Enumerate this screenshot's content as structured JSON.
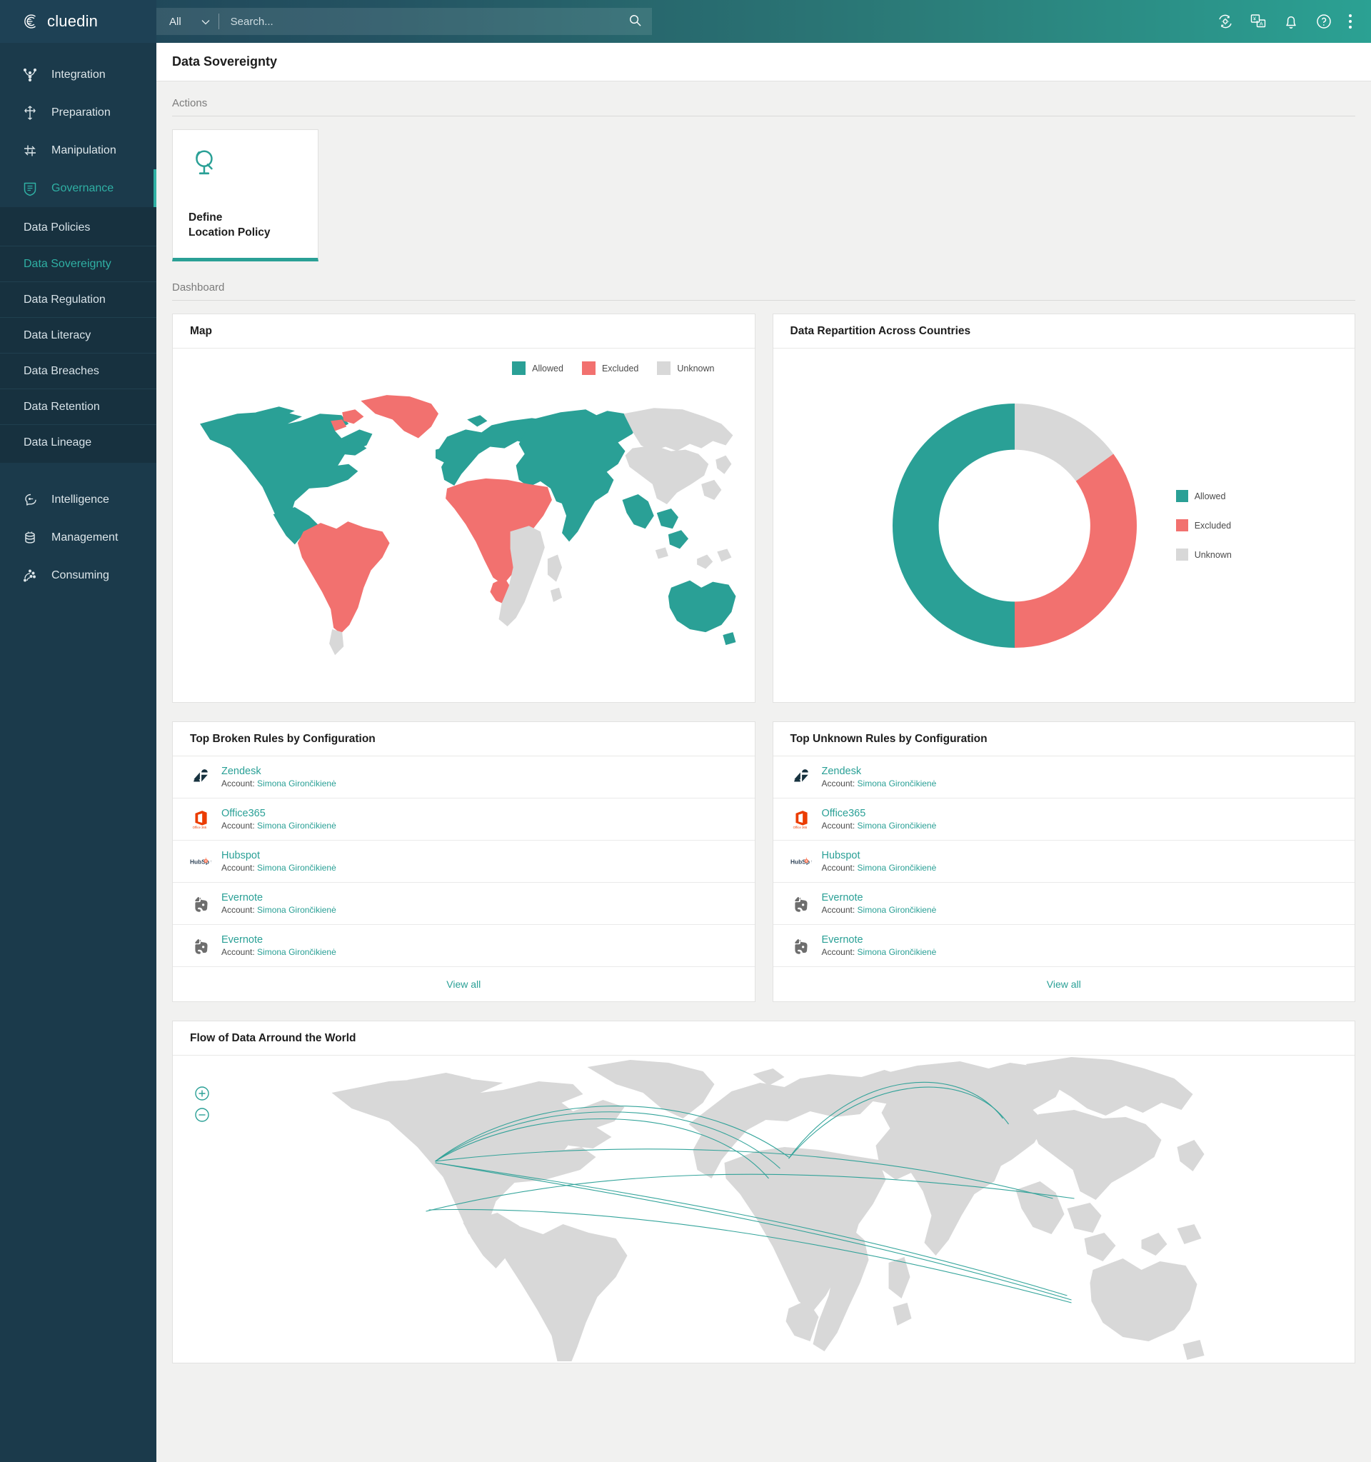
{
  "brand": {
    "name": "cluedin",
    "logo_icon": "cluedin-logo-icon"
  },
  "search": {
    "scope_label": "All",
    "placeholder": "Search...",
    "value": "",
    "search_icon": "search-icon",
    "chevron_icon": "chevron-down-icon"
  },
  "topbar_actions": [
    {
      "name": "sync-settings-icon",
      "label": "Sync Settings"
    },
    {
      "name": "language-icon",
      "label": "Language"
    },
    {
      "name": "notifications-bell-icon",
      "label": "Notifications"
    },
    {
      "name": "help-icon",
      "label": "Help"
    },
    {
      "name": "more-menu-icon",
      "label": "More"
    }
  ],
  "sidebar": {
    "items": [
      {
        "label": "Integration",
        "icon": "integration-icon",
        "active": false
      },
      {
        "label": "Preparation",
        "icon": "preparation-icon",
        "active": false
      },
      {
        "label": "Manipulation",
        "icon": "manipulation-icon",
        "active": false
      },
      {
        "label": "Governance",
        "icon": "governance-shield-icon",
        "active": true
      }
    ],
    "sub_items": [
      {
        "label": "Data Policies",
        "active": false
      },
      {
        "label": "Data Sovereignty",
        "active": true
      },
      {
        "label": "Data Regulation",
        "active": false
      },
      {
        "label": "Data Literacy",
        "active": false
      },
      {
        "label": "Data Breaches",
        "active": false
      },
      {
        "label": "Data Retention",
        "active": false
      },
      {
        "label": "Data Lineage",
        "active": false
      }
    ],
    "items_bottom": [
      {
        "label": "Intelligence",
        "icon": "intelligence-icon",
        "active": false
      },
      {
        "label": "Management",
        "icon": "management-database-icon",
        "active": false
      },
      {
        "label": "Consuming",
        "icon": "consuming-icon",
        "active": false
      }
    ]
  },
  "page": {
    "title": "Data Sovereignty"
  },
  "sections": {
    "actions_label": "Actions",
    "dashboard_label": "Dashboard"
  },
  "actions": [
    {
      "icon": "globe-icon",
      "label_line1": "Define",
      "label_line2": "Location Policy"
    }
  ],
  "colors": {
    "allowed": "#2aa096",
    "excluded": "#f2716f",
    "unknown": "#d8d8d8",
    "accent": "#2aa096",
    "sidebar": "#1b3a4b",
    "sidebar_sub": "#17313f"
  },
  "cards": {
    "map": {
      "title": "Map",
      "legend": [
        {
          "label": "Allowed",
          "color": "#2aa096"
        },
        {
          "label": "Excluded",
          "color": "#f2716f"
        },
        {
          "label": "Unknown",
          "color": "#d8d8d8"
        }
      ]
    },
    "repartition": {
      "title": "Data Repartition Across Countries",
      "legend": [
        {
          "label": "Allowed",
          "color": "#2aa096"
        },
        {
          "label": "Excluded",
          "color": "#f2716f"
        },
        {
          "label": "Unknown",
          "color": "#d8d8d8"
        }
      ]
    },
    "broken_rules": {
      "title": "Top Broken Rules by Configuration",
      "view_all": "View all",
      "account_prefix": "Account:",
      "rows": [
        {
          "provider": "Zendesk",
          "logo": "zendesk-logo-icon",
          "account": "Simona Girončikienė"
        },
        {
          "provider": "Office365",
          "logo": "office365-logo-icon",
          "account": "Simona Girončikienė"
        },
        {
          "provider": "Hubspot",
          "logo": "hubspot-logo-icon",
          "account": "Simona Girončikienė"
        },
        {
          "provider": "Evernote",
          "logo": "evernote-logo-icon",
          "account": "Simona Girončikienė"
        },
        {
          "provider": "Evernote",
          "logo": "evernote-logo-icon",
          "account": "Simona Girončikienė"
        }
      ]
    },
    "unknown_rules": {
      "title": "Top Unknown Rules by Configuration",
      "view_all": "View all",
      "account_prefix": "Account:",
      "rows": [
        {
          "provider": "Zendesk",
          "logo": "zendesk-logo-icon",
          "account": "Simona Girončikienė"
        },
        {
          "provider": "Office365",
          "logo": "office365-logo-icon",
          "account": "Simona Girončikienė"
        },
        {
          "provider": "Hubspot",
          "logo": "hubspot-logo-icon",
          "account": "Simona Girončikienė"
        },
        {
          "provider": "Evernote",
          "logo": "evernote-logo-icon",
          "account": "Simona Girončikienė"
        },
        {
          "provider": "Evernote",
          "logo": "evernote-logo-icon",
          "account": "Simona Girončikienė"
        }
      ]
    },
    "flow": {
      "title": "Flow of Data Arround the World",
      "zoom_in_icon": "zoom-in-icon",
      "zoom_out_icon": "zoom-out-icon"
    }
  },
  "chart_data": [
    {
      "type": "pie",
      "title": "Data Repartition Across Countries",
      "categories": [
        "Unknown",
        "Excluded",
        "Allowed"
      ],
      "values": [
        15,
        35,
        50
      ],
      "colors": [
        "#d8d8d8",
        "#f2716f",
        "#2aa096"
      ],
      "legend_position": "right",
      "donut": true,
      "inner_radius_ratio": 0.62,
      "start_angle_deg": 0
    },
    {
      "type": "heatmap",
      "title": "Map",
      "subtype": "choropleth",
      "legend": [
        "Allowed",
        "Excluded",
        "Unknown"
      ],
      "legend_colors": [
        "#2aa096",
        "#f2716f",
        "#d8d8d8"
      ],
      "regions": [
        {
          "name": "North America",
          "status": "Allowed",
          "color": "#2aa096"
        },
        {
          "name": "Greenland",
          "status": "Excluded",
          "color": "#f2716f"
        },
        {
          "name": "Iceland",
          "status": "Excluded",
          "color": "#f2716f"
        },
        {
          "name": "South America",
          "status": "Excluded",
          "color": "#f2716f"
        },
        {
          "name": "Europe",
          "status": "Allowed",
          "color": "#2aa096"
        },
        {
          "name": "Northern Africa",
          "status": "Excluded",
          "color": "#f2716f"
        },
        {
          "name": "Southern Africa",
          "status": "Unknown",
          "color": "#d8d8d8"
        },
        {
          "name": "Russia and Central Asia",
          "status": "Allowed",
          "color": "#2aa096"
        },
        {
          "name": "Eastern Siberia",
          "status": "Unknown",
          "color": "#d8d8d8"
        },
        {
          "name": "Southeast Asia",
          "status": "Allowed",
          "color": "#2aa096"
        },
        {
          "name": "China",
          "status": "Unknown",
          "color": "#d8d8d8"
        },
        {
          "name": "Australia",
          "status": "Allowed",
          "color": "#2aa096"
        }
      ]
    },
    {
      "type": "line",
      "title": "Flow of Data Arround the World",
      "subtype": "flow-map",
      "basemap_color": "#d8d8d8",
      "flow_color": "#2aa096",
      "flows": [
        {
          "from": "North America",
          "to": "Europe"
        },
        {
          "from": "North America",
          "to": "Europe"
        },
        {
          "from": "North America",
          "to": "Europe"
        },
        {
          "from": "North America",
          "to": "Asia"
        },
        {
          "from": "Europe",
          "to": "Asia"
        },
        {
          "from": "Europe",
          "to": "Asia"
        },
        {
          "from": "North America",
          "to": "Australia"
        },
        {
          "from": "North America",
          "to": "Australia"
        },
        {
          "from": "Asia",
          "to": "North America"
        }
      ]
    }
  ]
}
